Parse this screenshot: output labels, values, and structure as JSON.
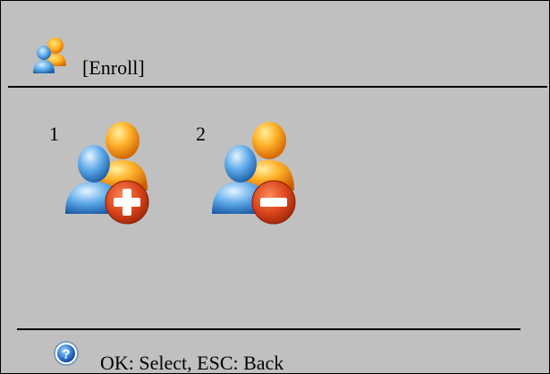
{
  "header": {
    "icon": "users-icon",
    "title": "[Enroll]"
  },
  "menu": {
    "items": [
      {
        "number": "1",
        "icon": "add-user-icon"
      },
      {
        "number": "2",
        "icon": "remove-user-icon"
      }
    ]
  },
  "footer": {
    "icon": "help-icon",
    "hint": "OK: Select, ESC: Back"
  },
  "colors": {
    "background": "#c0c0c0",
    "text": "#000000",
    "user_blue": "#4a9ee0",
    "user_orange": "#f5a623",
    "badge_red": "#d9441a"
  }
}
